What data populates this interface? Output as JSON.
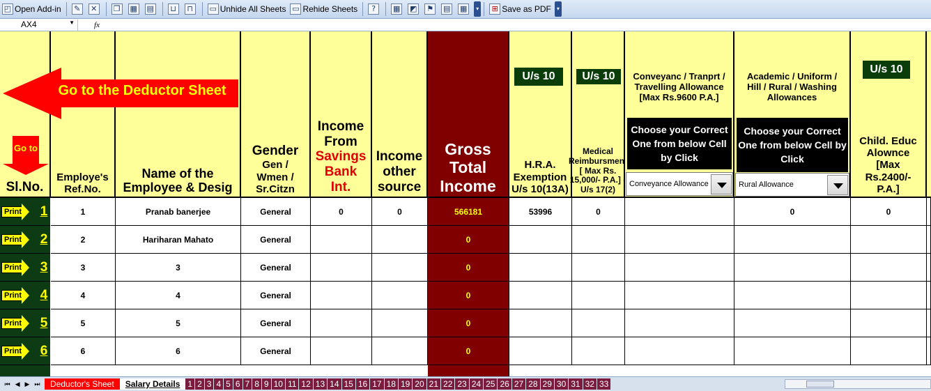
{
  "toolbar": {
    "open_addin": "Open Add-in",
    "unhide_all": "Unhide All Sheets",
    "rehide": "Rehide Sheets",
    "save_pdf": "Save as PDF"
  },
  "formula_bar": {
    "name_box": "AX4",
    "fx": "fx"
  },
  "banners": {
    "goto_deductor": "Go to the Deductor Sheet",
    "go_to": "Go to",
    "us10": "U/s 10",
    "choose_conveyance": "Choose your Correct One from below Cell by Click",
    "choose_academic": "Choose your Correct One from below Cell by Click"
  },
  "headers": {
    "slno": "Sl.No.",
    "ref": "Employe's Ref.No.",
    "name": "Name of the Employee & Desig",
    "gender_title": "Gender",
    "gender_sub": "Gen / Wmen / Sr.Citzn",
    "income_from": "Income From",
    "savings": "Savings Bank",
    "int": "Int.",
    "other": "Income other source",
    "gross": "Gross Total Income",
    "hra": "H.R.A. Exemption U/s 10(13A)",
    "medical": "Medical Reimbursment [ Max Rs. 15,000/- P.A.] ( U/s 17(2)",
    "conveyance": "Conveyanc / Tranprt / Travelling Allowance [Max Rs.9600 P.A.]",
    "academic": "Academic / Uniform / Hill / Rural / Washing Allowances",
    "child": "Child. Educ Alownce [Max Rs.2400/- P.A.]"
  },
  "combos": {
    "conveyance": "Conveyance Allowance",
    "academic": "Rural Allowance"
  },
  "print_label": "Print",
  "rows": [
    {
      "slno": "1",
      "ref": "1",
      "name": "Pranab banerjee",
      "gender": "General",
      "savings": "0",
      "other": "0",
      "gross": "566181",
      "hra": "53996",
      "medical": "0",
      "academic": "0",
      "child": "0"
    },
    {
      "slno": "2",
      "ref": "2",
      "name": "Hariharan Mahato",
      "gender": "General",
      "savings": "",
      "other": "",
      "gross": "0",
      "hra": "",
      "medical": "",
      "academic": "",
      "child": ""
    },
    {
      "slno": "3",
      "ref": "3",
      "name": "3",
      "gender": "General",
      "savings": "",
      "other": "",
      "gross": "0",
      "hra": "",
      "medical": "",
      "academic": "",
      "child": ""
    },
    {
      "slno": "4",
      "ref": "4",
      "name": "4",
      "gender": "General",
      "savings": "",
      "other": "",
      "gross": "0",
      "hra": "",
      "medical": "",
      "academic": "",
      "child": ""
    },
    {
      "slno": "5",
      "ref": "5",
      "name": "5",
      "gender": "General",
      "savings": "",
      "other": "",
      "gross": "0",
      "hra": "",
      "medical": "",
      "academic": "",
      "child": ""
    },
    {
      "slno": "6",
      "ref": "6",
      "name": "6",
      "gender": "General",
      "savings": "",
      "other": "",
      "gross": "0",
      "hra": "",
      "medical": "",
      "academic": "",
      "child": ""
    }
  ],
  "tabs": {
    "deductor": "Deductor's Sheet",
    "salary": "Salary Details",
    "numbers": [
      "1",
      "2",
      "3",
      "4",
      "5",
      "6",
      "7",
      "8",
      "9",
      "10",
      "11",
      "12",
      "13",
      "14",
      "15",
      "16",
      "17",
      "18",
      "19",
      "20",
      "21",
      "22",
      "23",
      "24",
      "25",
      "26",
      "27",
      "28",
      "29",
      "30",
      "31",
      "32",
      "33"
    ]
  },
  "colors": {
    "gross_bg": "#800000",
    "header_bg": "#ffff99",
    "print_bg": "#0d3b13"
  }
}
